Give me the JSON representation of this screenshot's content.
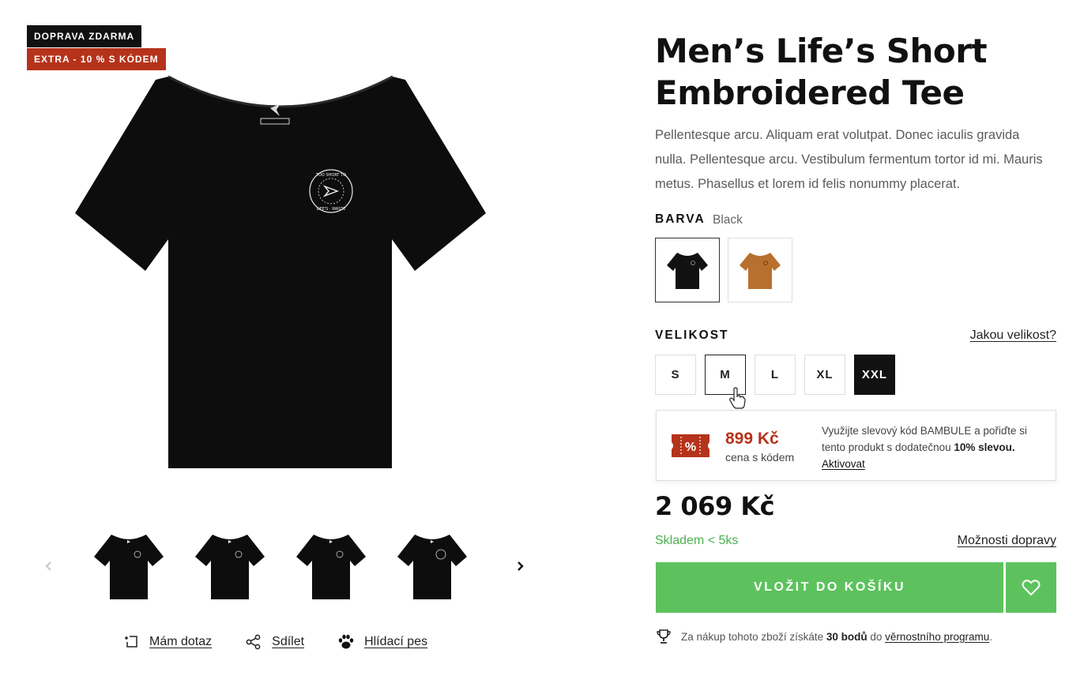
{
  "badges": {
    "shipping": "DOPRAVA ZDARMA",
    "discount": "EXTRA - 10 % S KÓDEM"
  },
  "product": {
    "title": "Men’s Life’s Short Embroidered Tee",
    "description": "Pellentesque arcu. Aliquam erat volutpat. Donec iaculis gravida nulla. Pellentesque arcu. Vestibulum fermentum tortor id mi. Mauris metus. Phasellus et lorem id felis nonummy placerat.",
    "print_text": "TOO SHORT TO WASTE · LIFE'S"
  },
  "color": {
    "label": "BARVA",
    "value": "Black",
    "options": [
      {
        "name": "Black",
        "hex": "#111111",
        "selected": true
      },
      {
        "name": "Brown",
        "hex": "#b8702e",
        "selected": false
      }
    ]
  },
  "size": {
    "label": "VELIKOST",
    "guide": "Jakou velikost?",
    "options": [
      "S",
      "M",
      "L",
      "XL",
      "XXL"
    ],
    "hovered": "M",
    "active": "XXL"
  },
  "promo": {
    "tag": "%",
    "price": "899 Kč",
    "price_sub": "cena s kódem",
    "text_1": "Využijte slevový kód BAMBULE a pořiďte si tento produkt s dodatečnou ",
    "text_bold": "10% slevou.",
    "activate": "Aktivovat",
    "accent": "#b5331a"
  },
  "price": "2 069 Kč",
  "stock": "Skladem < 5ks",
  "shipping_options": "Možnosti dopravy",
  "cart": {
    "label": "VLOŽIT DO KOŠÍKU",
    "color": "#5dc25d"
  },
  "loyalty": {
    "pre": "Za nákup tohoto zboží získáte ",
    "points": "30 bodů",
    "mid": " do ",
    "link": "věrnostního programu",
    "post": "."
  },
  "actions": {
    "question": "Mám dotaz",
    "share": "Sdílet",
    "watchdog": "Hlídací pes"
  },
  "icons": {
    "prev": "chevron-left-icon",
    "next": "chevron-right-icon",
    "question": "question-icon",
    "share": "share-icon",
    "watchdog": "paw-icon",
    "wishlist": "heart-icon",
    "loyalty": "trophy-icon"
  }
}
